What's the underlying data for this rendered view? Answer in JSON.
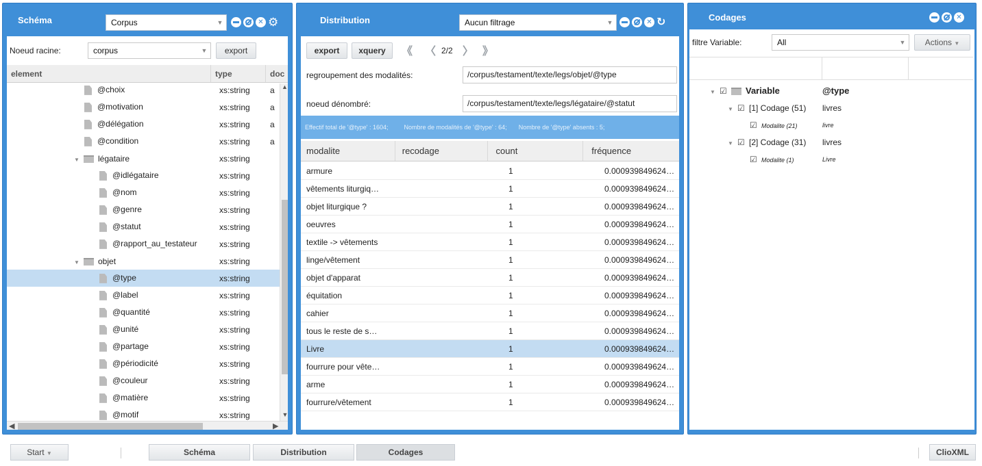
{
  "schema": {
    "title": "Schéma",
    "combo_value": "Corpus",
    "root_label": "Noeud racine:",
    "root_value": "corpus",
    "export_label": "export",
    "columns": [
      "element",
      "type",
      "doc"
    ],
    "rows": [
      {
        "kind": "attr",
        "level": 2,
        "name": "@choix",
        "type": "xs:string",
        "doc": "a"
      },
      {
        "kind": "attr",
        "level": 2,
        "name": "@motivation",
        "type": "xs:string",
        "doc": "a"
      },
      {
        "kind": "attr",
        "level": 2,
        "name": "@délégation",
        "type": "xs:string",
        "doc": "a"
      },
      {
        "kind": "attr",
        "level": 2,
        "name": "@condition",
        "type": "xs:string",
        "doc": "a"
      },
      {
        "kind": "folder",
        "level": 1,
        "name": "légataire",
        "type": "xs:string",
        "doc": ""
      },
      {
        "kind": "attr",
        "level": 3,
        "name": "@idlégataire",
        "type": "xs:string",
        "doc": ""
      },
      {
        "kind": "attr",
        "level": 3,
        "name": "@nom",
        "type": "xs:string",
        "doc": ""
      },
      {
        "kind": "attr",
        "level": 3,
        "name": "@genre",
        "type": "xs:string",
        "doc": ""
      },
      {
        "kind": "attr",
        "level": 3,
        "name": "@statut",
        "type": "xs:string",
        "doc": ""
      },
      {
        "kind": "attr",
        "level": 3,
        "name": "@rapport_au_testateur",
        "type": "xs:string",
        "doc": ""
      },
      {
        "kind": "folder",
        "level": 1,
        "name": "objet",
        "type": "xs:string",
        "doc": ""
      },
      {
        "kind": "attr",
        "level": 3,
        "name": "@type",
        "type": "xs:string",
        "doc": "",
        "selected": true
      },
      {
        "kind": "attr",
        "level": 3,
        "name": "@label",
        "type": "xs:string",
        "doc": ""
      },
      {
        "kind": "attr",
        "level": 3,
        "name": "@quantité",
        "type": "xs:string",
        "doc": ""
      },
      {
        "kind": "attr",
        "level": 3,
        "name": "@unité",
        "type": "xs:string",
        "doc": ""
      },
      {
        "kind": "attr",
        "level": 3,
        "name": "@partage",
        "type": "xs:string",
        "doc": ""
      },
      {
        "kind": "attr",
        "level": 3,
        "name": "@périodicité",
        "type": "xs:string",
        "doc": ""
      },
      {
        "kind": "attr",
        "level": 3,
        "name": "@couleur",
        "type": "xs:string",
        "doc": ""
      },
      {
        "kind": "attr",
        "level": 3,
        "name": "@matière",
        "type": "xs:string",
        "doc": ""
      },
      {
        "kind": "attr",
        "level": 3,
        "name": "@motif",
        "type": "xs:string",
        "doc": ""
      }
    ]
  },
  "distribution": {
    "title": "Distribution",
    "combo_value": "Aucun filtrage",
    "export_label": "export",
    "xquery_label": "xquery",
    "page_indicator": "2/2",
    "group_label": "regroupement des modalités:",
    "group_value": "/corpus/testament/texte/legs/objet/@type",
    "counted_label": "noeud dénombré:",
    "counted_value": "/corpus/testament/texte/legs/légataire/@statut",
    "stats": {
      "total": "Effectif total de '@type' : 1604;",
      "modalities": "Nombre de modalités de '@type' : 64;",
      "absent": "Nombre de '@type' absents : 5;"
    },
    "columns": [
      "modalite",
      "recodage",
      "count",
      "fréquence"
    ],
    "rows": [
      {
        "modalite": "armure",
        "recodage": "",
        "count": "1",
        "frequence": "0.000939849624…"
      },
      {
        "modalite": "vêtements liturgiq…",
        "recodage": "",
        "count": "1",
        "frequence": "0.000939849624…"
      },
      {
        "modalite": "objet liturgique ?",
        "recodage": "",
        "count": "1",
        "frequence": "0.000939849624…"
      },
      {
        "modalite": "oeuvres",
        "recodage": "",
        "count": "1",
        "frequence": "0.000939849624…"
      },
      {
        "modalite": "textile -> vêtements",
        "recodage": "",
        "count": "1",
        "frequence": "0.000939849624…"
      },
      {
        "modalite": "linge/vêtement",
        "recodage": "",
        "count": "1",
        "frequence": "0.000939849624…"
      },
      {
        "modalite": "objet d'apparat",
        "recodage": "",
        "count": "1",
        "frequence": "0.000939849624…"
      },
      {
        "modalite": "équitation",
        "recodage": "",
        "count": "1",
        "frequence": "0.000939849624…"
      },
      {
        "modalite": "cahier",
        "recodage": "",
        "count": "1",
        "frequence": "0.000939849624…"
      },
      {
        "modalite": "tous le reste de s…",
        "recodage": "",
        "count": "1",
        "frequence": "0.000939849624…"
      },
      {
        "modalite": "Livre",
        "recodage": "",
        "count": "1",
        "frequence": "0.000939849624…",
        "selected": true
      },
      {
        "modalite": "fourrure pour vête…",
        "recodage": "",
        "count": "1",
        "frequence": "0.000939849624…"
      },
      {
        "modalite": "arme",
        "recodage": "",
        "count": "1",
        "frequence": "0.000939849624…"
      },
      {
        "modalite": "fourrure/vêtement",
        "recodage": "",
        "count": "1",
        "frequence": "0.000939849624…"
      }
    ]
  },
  "codages": {
    "title": "Codages",
    "filter_label": "filtre Variable:",
    "filter_value": "All",
    "actions_label": "Actions",
    "tree": [
      {
        "level": 0,
        "label": "Variable",
        "value": "@type",
        "bold": true,
        "folder": true
      },
      {
        "level": 1,
        "label": "[1] Codage (51)",
        "value": "livres"
      },
      {
        "level": 2,
        "label": "Modalite (21)",
        "value": "livre",
        "italic": true
      },
      {
        "level": 1,
        "label": "[2] Codage (31)",
        "value": "livres"
      },
      {
        "level": 2,
        "label": "Modalite (1)",
        "value": "Livre",
        "italic": true
      }
    ]
  },
  "taskbar": {
    "start_label": "Start",
    "buttons": [
      "Schéma",
      "Distribution",
      "Codages"
    ],
    "app_label": "ClioXML"
  },
  "colors": {
    "panel_blue": "#3f8fd8",
    "selection": "#c3dcf2",
    "stats_bar": "#6fb0e8"
  }
}
